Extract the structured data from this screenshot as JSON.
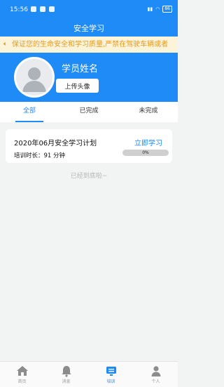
{
  "status_bar": {
    "time": "15:56",
    "battery": "86"
  },
  "header": {
    "title": "安全学习"
  },
  "notice": {
    "text": "保证您的生命安全和学习质量,严禁在驾驶车辆或者"
  },
  "profile": {
    "name": "学员姓名",
    "upload_label": "上传头像"
  },
  "tabs": [
    {
      "label": "全部",
      "active": true
    },
    {
      "label": "已完成",
      "active": false
    },
    {
      "label": "未完成",
      "active": false
    }
  ],
  "plans": [
    {
      "title": "2020年06月安全学习计划",
      "duration": "培训时长：91 分钟",
      "action": "立即学习",
      "progress_text": "0%",
      "progress": 0
    }
  ],
  "list_end": "已经到底啦~",
  "bottom_nav": [
    {
      "label": "首页",
      "icon": "home-icon"
    },
    {
      "label": "消息",
      "icon": "bell-icon"
    },
    {
      "label": "培训",
      "icon": "training-icon",
      "active": true
    },
    {
      "label": "个人",
      "icon": "person-icon"
    }
  ],
  "colors": {
    "primary": "#1e8bf6",
    "notice_bg": "#fbf4d9",
    "notice_text": "#e79a1e"
  }
}
